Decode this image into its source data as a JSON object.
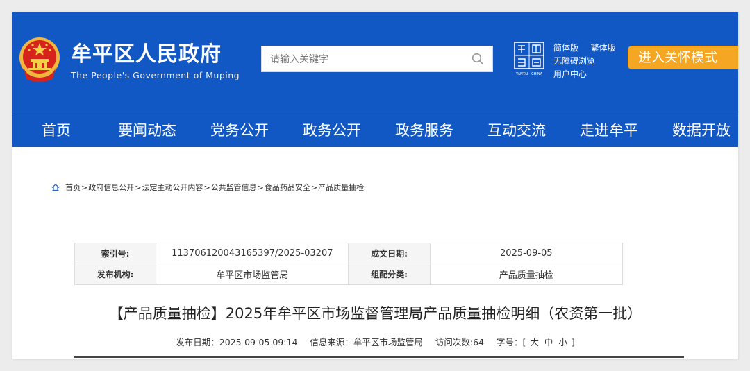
{
  "header": {
    "site_title": "牟平区人民政府",
    "site_subtitle": "The People's Government of Muping",
    "search_placeholder": "请输入关键字",
    "seal_caption": "YANTAI · CHINA",
    "links": {
      "simplified": "简体版",
      "traditional": "繁体版",
      "accessible": "无障碍浏览",
      "user_center": "用户中心"
    },
    "care_mode_label": "进入关怀模式",
    "colors": {
      "primary": "#1258c5",
      "accent": "#f5a623"
    }
  },
  "nav": {
    "items": [
      {
        "label": "首页"
      },
      {
        "label": "要闻动态"
      },
      {
        "label": "党务公开"
      },
      {
        "label": "政务公开"
      },
      {
        "label": "政务服务"
      },
      {
        "label": "互动交流"
      },
      {
        "label": "走进牟平"
      },
      {
        "label": "数据开放"
      }
    ]
  },
  "breadcrumb": {
    "items": [
      "首页",
      "政府信息公开",
      "法定主动公开内容",
      "公共监管信息",
      "食品药品安全",
      "产品质量抽检"
    ],
    "separator": ">"
  },
  "meta_table": {
    "index_label": "索引号:",
    "index_value": "113706120043165397/2025-03207",
    "date_label": "成文日期:",
    "date_value": "2025-09-05",
    "org_label": "发布机构:",
    "org_value": "牟平区市场监管局",
    "category_label": "组配分类:",
    "category_value": "产品质量抽检"
  },
  "article": {
    "title": "【产品质量抽检】2025年牟平区市场监督管理局产品质量抽检明细（农资第一批）",
    "publish_date": "发布日期：2025-09-05 09:14",
    "source": "信息来源：牟平区市场监管局",
    "visits": "访问次数:64",
    "font_size_label": "字号：[",
    "font_large": "大",
    "font_medium": "中",
    "font_small": "小",
    "font_size_close": "]"
  }
}
